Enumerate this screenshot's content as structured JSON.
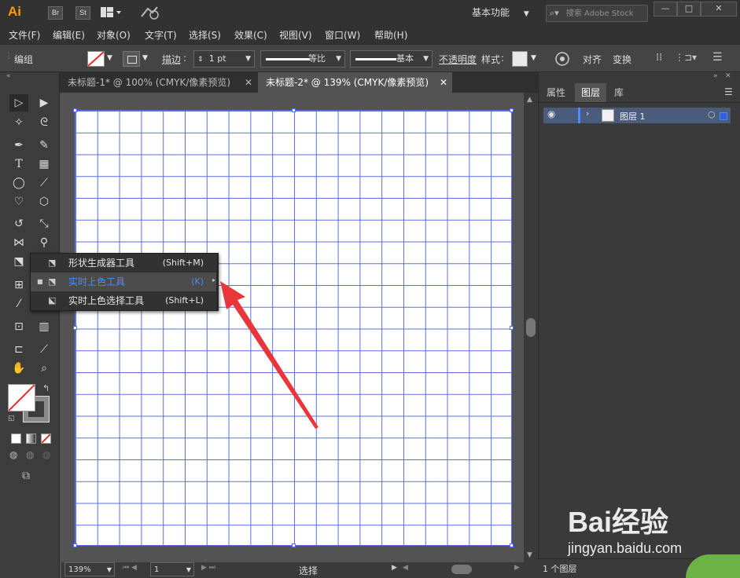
{
  "titlebar": {
    "app_logo": "Ai",
    "bridge_label": "Br",
    "stock_label": "St",
    "workspace": "基本功能",
    "search_placeholder": "搜索 Adobe Stock",
    "minimize": "—",
    "maximize": "□",
    "close": "✕"
  },
  "menubar": {
    "items": [
      "文件(F)",
      "编辑(E)",
      "对象(O)",
      "文字(T)",
      "选择(S)",
      "效果(C)",
      "视图(V)",
      "窗口(W)",
      "帮助(H)"
    ]
  },
  "controlbar": {
    "selection_label": "编组",
    "stroke_label": "描边",
    "stroke_weight": "1 pt",
    "stroke_profile": "等比",
    "brush_def": "基本",
    "opacity_label": "不透明度",
    "style_label": "样式",
    "align_label": "对齐",
    "transform_label": "变换"
  },
  "doctabs": [
    {
      "label": "未标题-1* @ 100% (CMYK/像素预览)",
      "active": false
    },
    {
      "label": "未标题-2* @ 139% (CMYK/像素预览)",
      "active": true
    }
  ],
  "flyout": {
    "items": [
      {
        "label": "形状生成器工具",
        "shortcut": "(Shift+M)",
        "selected": false
      },
      {
        "label": "实时上色工具",
        "shortcut": "(K)",
        "selected": true
      },
      {
        "label": "实时上色选择工具",
        "shortcut": "(Shift+L)",
        "selected": false
      }
    ]
  },
  "status": {
    "zoom": "139%",
    "page": "1",
    "mode": "选择"
  },
  "panel": {
    "tabs": [
      {
        "label": "属性",
        "active": false
      },
      {
        "label": "图层",
        "active": true
      },
      {
        "label": "库",
        "active": false
      }
    ],
    "layer_name": "图层 1",
    "layer_count": "1 个图层"
  },
  "watermark": {
    "text": "Bai经验",
    "url": "jingyan.baidu.com"
  },
  "colors": {
    "accent": "#4d8dff",
    "grid": "#5a6ee0",
    "arrow": "#e8363a"
  }
}
